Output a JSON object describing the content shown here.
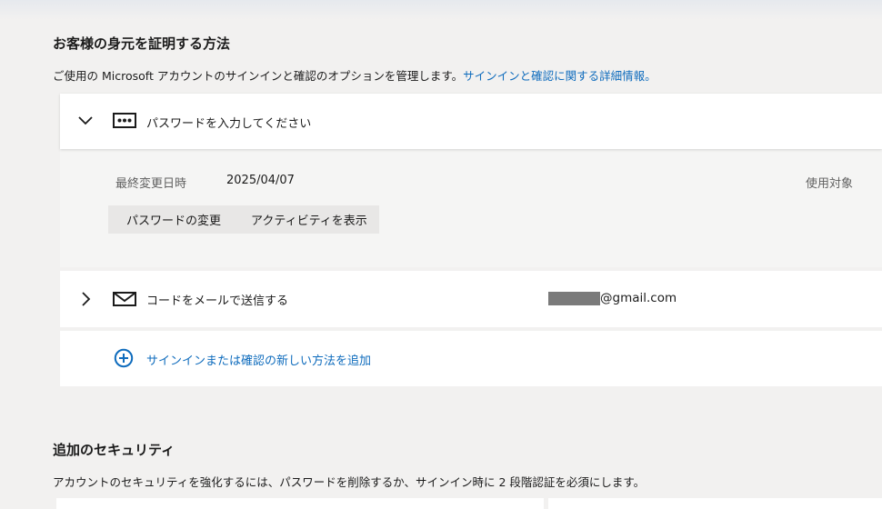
{
  "identity": {
    "title": "お客様の身元を証明する方法",
    "description": "ご使用の Microsoft アカウントのサインインと確認のオプションを管理します。",
    "link": "サインインと確認に関する詳細情報。"
  },
  "password": {
    "label": "パスワードを入力してください",
    "last_changed_label": "最終変更日時",
    "last_changed_value": "2025/04/07",
    "used_for_label": "使用対象",
    "change_button": "パスワードの変更",
    "activity_button": "アクティビティを表示"
  },
  "email_code": {
    "label": "コードをメールで送信する",
    "email_suffix": "@gmail.com"
  },
  "add_method": {
    "label": "サインインまたは確認の新しい方法を追加"
  },
  "additional_security": {
    "title": "追加のセキュリティ",
    "description": "アカウントのセキュリティを強化するには、パスワードを削除するか、サインイン時に 2 段階認証を必須にします。"
  }
}
